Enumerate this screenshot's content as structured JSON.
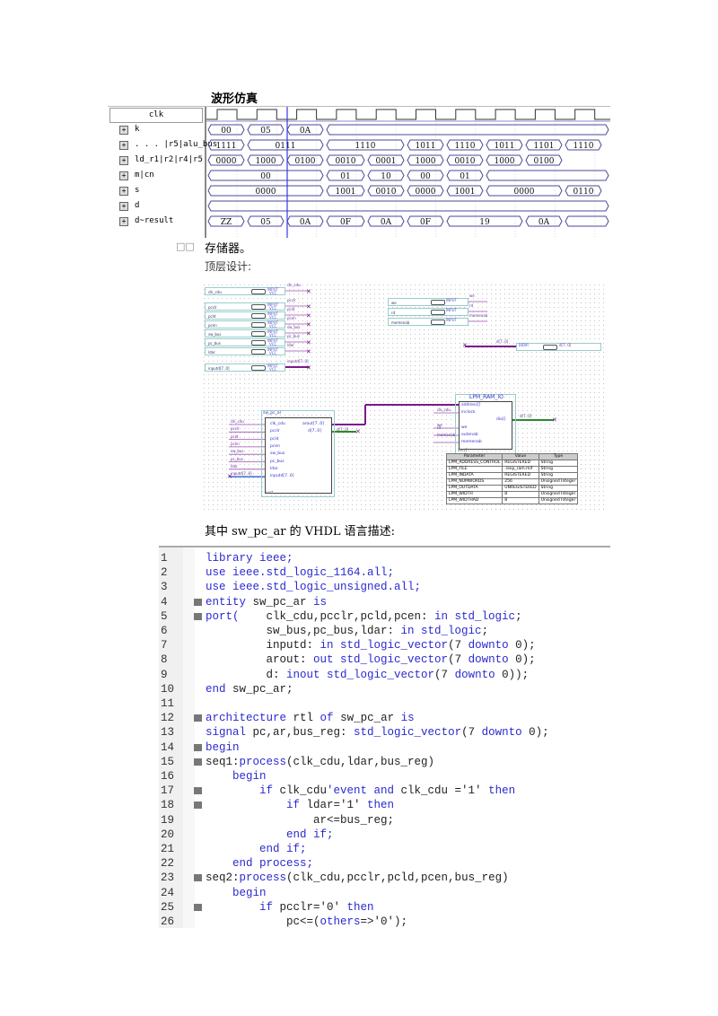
{
  "sections": {
    "waveform_title": "波形仿真",
    "storage_heading_bullet": "□□",
    "storage_heading": "存储器。",
    "top_design_label": "顶层设计:",
    "vhdl_intro": "其中 sw_pc_ar 的 VHDL 语言描述:"
  },
  "waveform": {
    "clk_label": "clk",
    "signals": [
      {
        "name": "k",
        "segments": [
          "00",
          "05",
          "0A",
          ""
        ]
      },
      {
        "name": ". . . |r5|alu_bus",
        "segments": [
          "1111",
          "0111",
          "1110",
          "1011",
          "1110",
          "1011",
          "1101",
          "1110"
        ]
      },
      {
        "name": "ld_r1|r2|r4|r5",
        "segments": [
          "0000",
          "1000",
          "0100",
          "0010",
          "0001",
          "1000",
          "0010",
          "1000",
          "0100",
          ""
        ]
      },
      {
        "name": "m|cn",
        "segments": [
          "00",
          "01",
          "10",
          "00",
          "01",
          ""
        ]
      },
      {
        "name": "s",
        "segments": [
          "0000",
          "1001",
          "0010",
          "0000",
          "1001",
          "0000",
          "0110"
        ]
      },
      {
        "name": "d",
        "segments": [
          ""
        ]
      },
      {
        "name": "d~result",
        "segments": [
          "ZZ",
          "05",
          "0A",
          "0F",
          "0A",
          "0F",
          "19",
          "0A",
          ""
        ]
      }
    ]
  },
  "schematic": {
    "input_pins_left": [
      "clk_cdu",
      "pcclr",
      "pcld",
      "pcen",
      "sw_bus",
      "pc_bus",
      "ldar",
      "inputd[7..0]"
    ],
    "input_pins_right": [
      "we",
      "rd",
      "memenab"
    ],
    "pin_type": "INPUT",
    "pin_vcc": "VCC",
    "bidir_pin": "d[7..0]",
    "bidir_type": "BIDIR",
    "bidir_net": "d[7..0]",
    "block1": {
      "title": "sw_pc_ar",
      "inputs": [
        "clk_cdu",
        "pcclr",
        "pcld",
        "pcen",
        "sw_bus",
        "pc_bus",
        "ldar",
        "inputd[7..0]"
      ],
      "outputs": [
        "arout[7..0]",
        "d[7..0]"
      ],
      "instance": "inst"
    },
    "block2": {
      "title": "LPM_RAM_IO",
      "inputs": [
        "address[]",
        "inclock",
        "we",
        "outenab",
        "memenab"
      ],
      "outputs": [
        "dio[]"
      ],
      "instance": "inst1",
      "input_nets": [
        "clk_cdu",
        "we",
        "rd",
        "memenab"
      ]
    },
    "param_table": {
      "headers": [
        "Parameter",
        "Value",
        "Type"
      ],
      "rows": [
        [
          "LPM_ADDRESS_CONTROL",
          "REGISTERED",
          "String"
        ],
        [
          "LPM_FILE",
          "./exp_ram.mif",
          "String"
        ],
        [
          "LPM_INDATA",
          "REGISTERED",
          "String"
        ],
        [
          "LPM_NUMWORDS",
          "256",
          "Unsigned Integer"
        ],
        [
          "LPM_OUTDATA",
          "UNREGISTERED",
          "String"
        ],
        [
          "LPM_WIDTH",
          "8",
          "Unsigned Integer"
        ],
        [
          "LPM_WIDTHAD",
          "8",
          "Unsigned Integer"
        ]
      ]
    }
  },
  "code": {
    "lines": [
      {
        "n": "1",
        "fold": false,
        "indent": 0,
        "parts": [
          [
            "kw",
            "library ieee;"
          ]
        ]
      },
      {
        "n": "2",
        "fold": false,
        "indent": 0,
        "parts": [
          [
            "kw",
            "use ieee.std_logic_1164.all;"
          ]
        ]
      },
      {
        "n": "3",
        "fold": false,
        "indent": 0,
        "parts": [
          [
            "kw",
            "use ieee.std_logic_unsigned.all;"
          ]
        ]
      },
      {
        "n": "4",
        "fold": true,
        "indent": 0,
        "parts": [
          [
            "kw",
            "entity "
          ],
          [
            "t",
            "sw_pc_ar "
          ],
          [
            "kw",
            "is"
          ]
        ]
      },
      {
        "n": "5",
        "fold": true,
        "indent": 0,
        "parts": [
          [
            "kw",
            "port(    "
          ],
          [
            "t",
            "clk_cdu,pcclr,pcld,pcen: "
          ],
          [
            "kw",
            "in std_logic"
          ],
          [
            "t",
            ";"
          ]
        ]
      },
      {
        "n": "6",
        "fold": false,
        "indent": 0,
        "parts": [
          [
            "t",
            "         sw_bus,pc_bus,ldar: "
          ],
          [
            "kw",
            "in std_logic"
          ],
          [
            "t",
            ";"
          ]
        ]
      },
      {
        "n": "7",
        "fold": false,
        "indent": 0,
        "parts": [
          [
            "t",
            "         inputd: "
          ],
          [
            "kw",
            "in std_logic_vector"
          ],
          [
            "t",
            "(7 "
          ],
          [
            "kw",
            "downto"
          ],
          [
            "t",
            " 0);"
          ]
        ]
      },
      {
        "n": "8",
        "fold": false,
        "indent": 0,
        "parts": [
          [
            "t",
            "         arout: "
          ],
          [
            "kw",
            "out std_logic_vector"
          ],
          [
            "t",
            "(7 "
          ],
          [
            "kw",
            "downto"
          ],
          [
            "t",
            " 0);"
          ]
        ]
      },
      {
        "n": "9",
        "fold": false,
        "indent": 0,
        "parts": [
          [
            "t",
            "         d: "
          ],
          [
            "kw",
            "inout std_logic_vector"
          ],
          [
            "t",
            "(7 "
          ],
          [
            "kw",
            "downto"
          ],
          [
            "t",
            " 0));"
          ]
        ]
      },
      {
        "n": "10",
        "fold": false,
        "indent": 0,
        "parts": [
          [
            "kw",
            "end "
          ],
          [
            "t",
            "sw_pc_ar;"
          ]
        ]
      },
      {
        "n": "11",
        "fold": false,
        "indent": 0,
        "parts": []
      },
      {
        "n": "12",
        "fold": true,
        "indent": 0,
        "parts": [
          [
            "kw",
            "architecture "
          ],
          [
            "t",
            "rtl "
          ],
          [
            "kw",
            "of "
          ],
          [
            "t",
            "sw_pc_ar "
          ],
          [
            "kw",
            "is"
          ]
        ]
      },
      {
        "n": "13",
        "fold": false,
        "indent": 0,
        "parts": [
          [
            "kw",
            "signal "
          ],
          [
            "t",
            "pc,ar,bus_reg: "
          ],
          [
            "kw",
            "std_logic_vector"
          ],
          [
            "t",
            "(7 "
          ],
          [
            "kw",
            "downto"
          ],
          [
            "t",
            " 0);"
          ]
        ]
      },
      {
        "n": "14",
        "fold": true,
        "indent": 0,
        "parts": [
          [
            "kw",
            "begin"
          ]
        ]
      },
      {
        "n": "15",
        "fold": true,
        "indent": 0,
        "parts": [
          [
            "t",
            "seq1:"
          ],
          [
            "kw",
            "process"
          ],
          [
            "t",
            "(clk_cdu,ldar,bus_reg)"
          ]
        ]
      },
      {
        "n": "16",
        "fold": false,
        "indent": 0,
        "parts": [
          [
            "kw",
            "    begin"
          ]
        ]
      },
      {
        "n": "17",
        "fold": true,
        "indent": 0,
        "parts": [
          [
            "kw",
            "        if "
          ],
          [
            "t",
            "clk_cdu"
          ],
          [
            "kw",
            "'event and "
          ],
          [
            "t",
            "clk_cdu ='1' "
          ],
          [
            "kw",
            "then"
          ]
        ]
      },
      {
        "n": "18",
        "fold": true,
        "indent": 0,
        "parts": [
          [
            "kw",
            "            if "
          ],
          [
            "t",
            "ldar='1' "
          ],
          [
            "kw",
            "then"
          ]
        ]
      },
      {
        "n": "19",
        "fold": false,
        "indent": 0,
        "parts": [
          [
            "t",
            "                ar<=bus_reg;"
          ]
        ]
      },
      {
        "n": "20",
        "fold": false,
        "indent": 0,
        "parts": [
          [
            "kw",
            "            end if;"
          ]
        ]
      },
      {
        "n": "21",
        "fold": false,
        "indent": 0,
        "parts": [
          [
            "kw",
            "        end if;"
          ]
        ]
      },
      {
        "n": "22",
        "fold": false,
        "indent": 0,
        "parts": [
          [
            "kw",
            "    end process;"
          ]
        ]
      },
      {
        "n": "23",
        "fold": true,
        "indent": 0,
        "parts": [
          [
            "t",
            "seq2:"
          ],
          [
            "kw",
            "process"
          ],
          [
            "t",
            "(clk_cdu,pcclr,pcld,pcen,bus_reg)"
          ]
        ]
      },
      {
        "n": "24",
        "fold": false,
        "indent": 0,
        "parts": [
          [
            "kw",
            "    begin"
          ]
        ]
      },
      {
        "n": "25",
        "fold": true,
        "indent": 0,
        "parts": [
          [
            "kw",
            "        if "
          ],
          [
            "t",
            "pcclr='0' "
          ],
          [
            "kw",
            "then"
          ]
        ]
      },
      {
        "n": "26",
        "fold": false,
        "indent": 0,
        "parts": [
          [
            "t",
            "            pc<=("
          ],
          [
            "kw",
            "others"
          ],
          [
            "t",
            "=>'0');"
          ]
        ]
      }
    ]
  }
}
